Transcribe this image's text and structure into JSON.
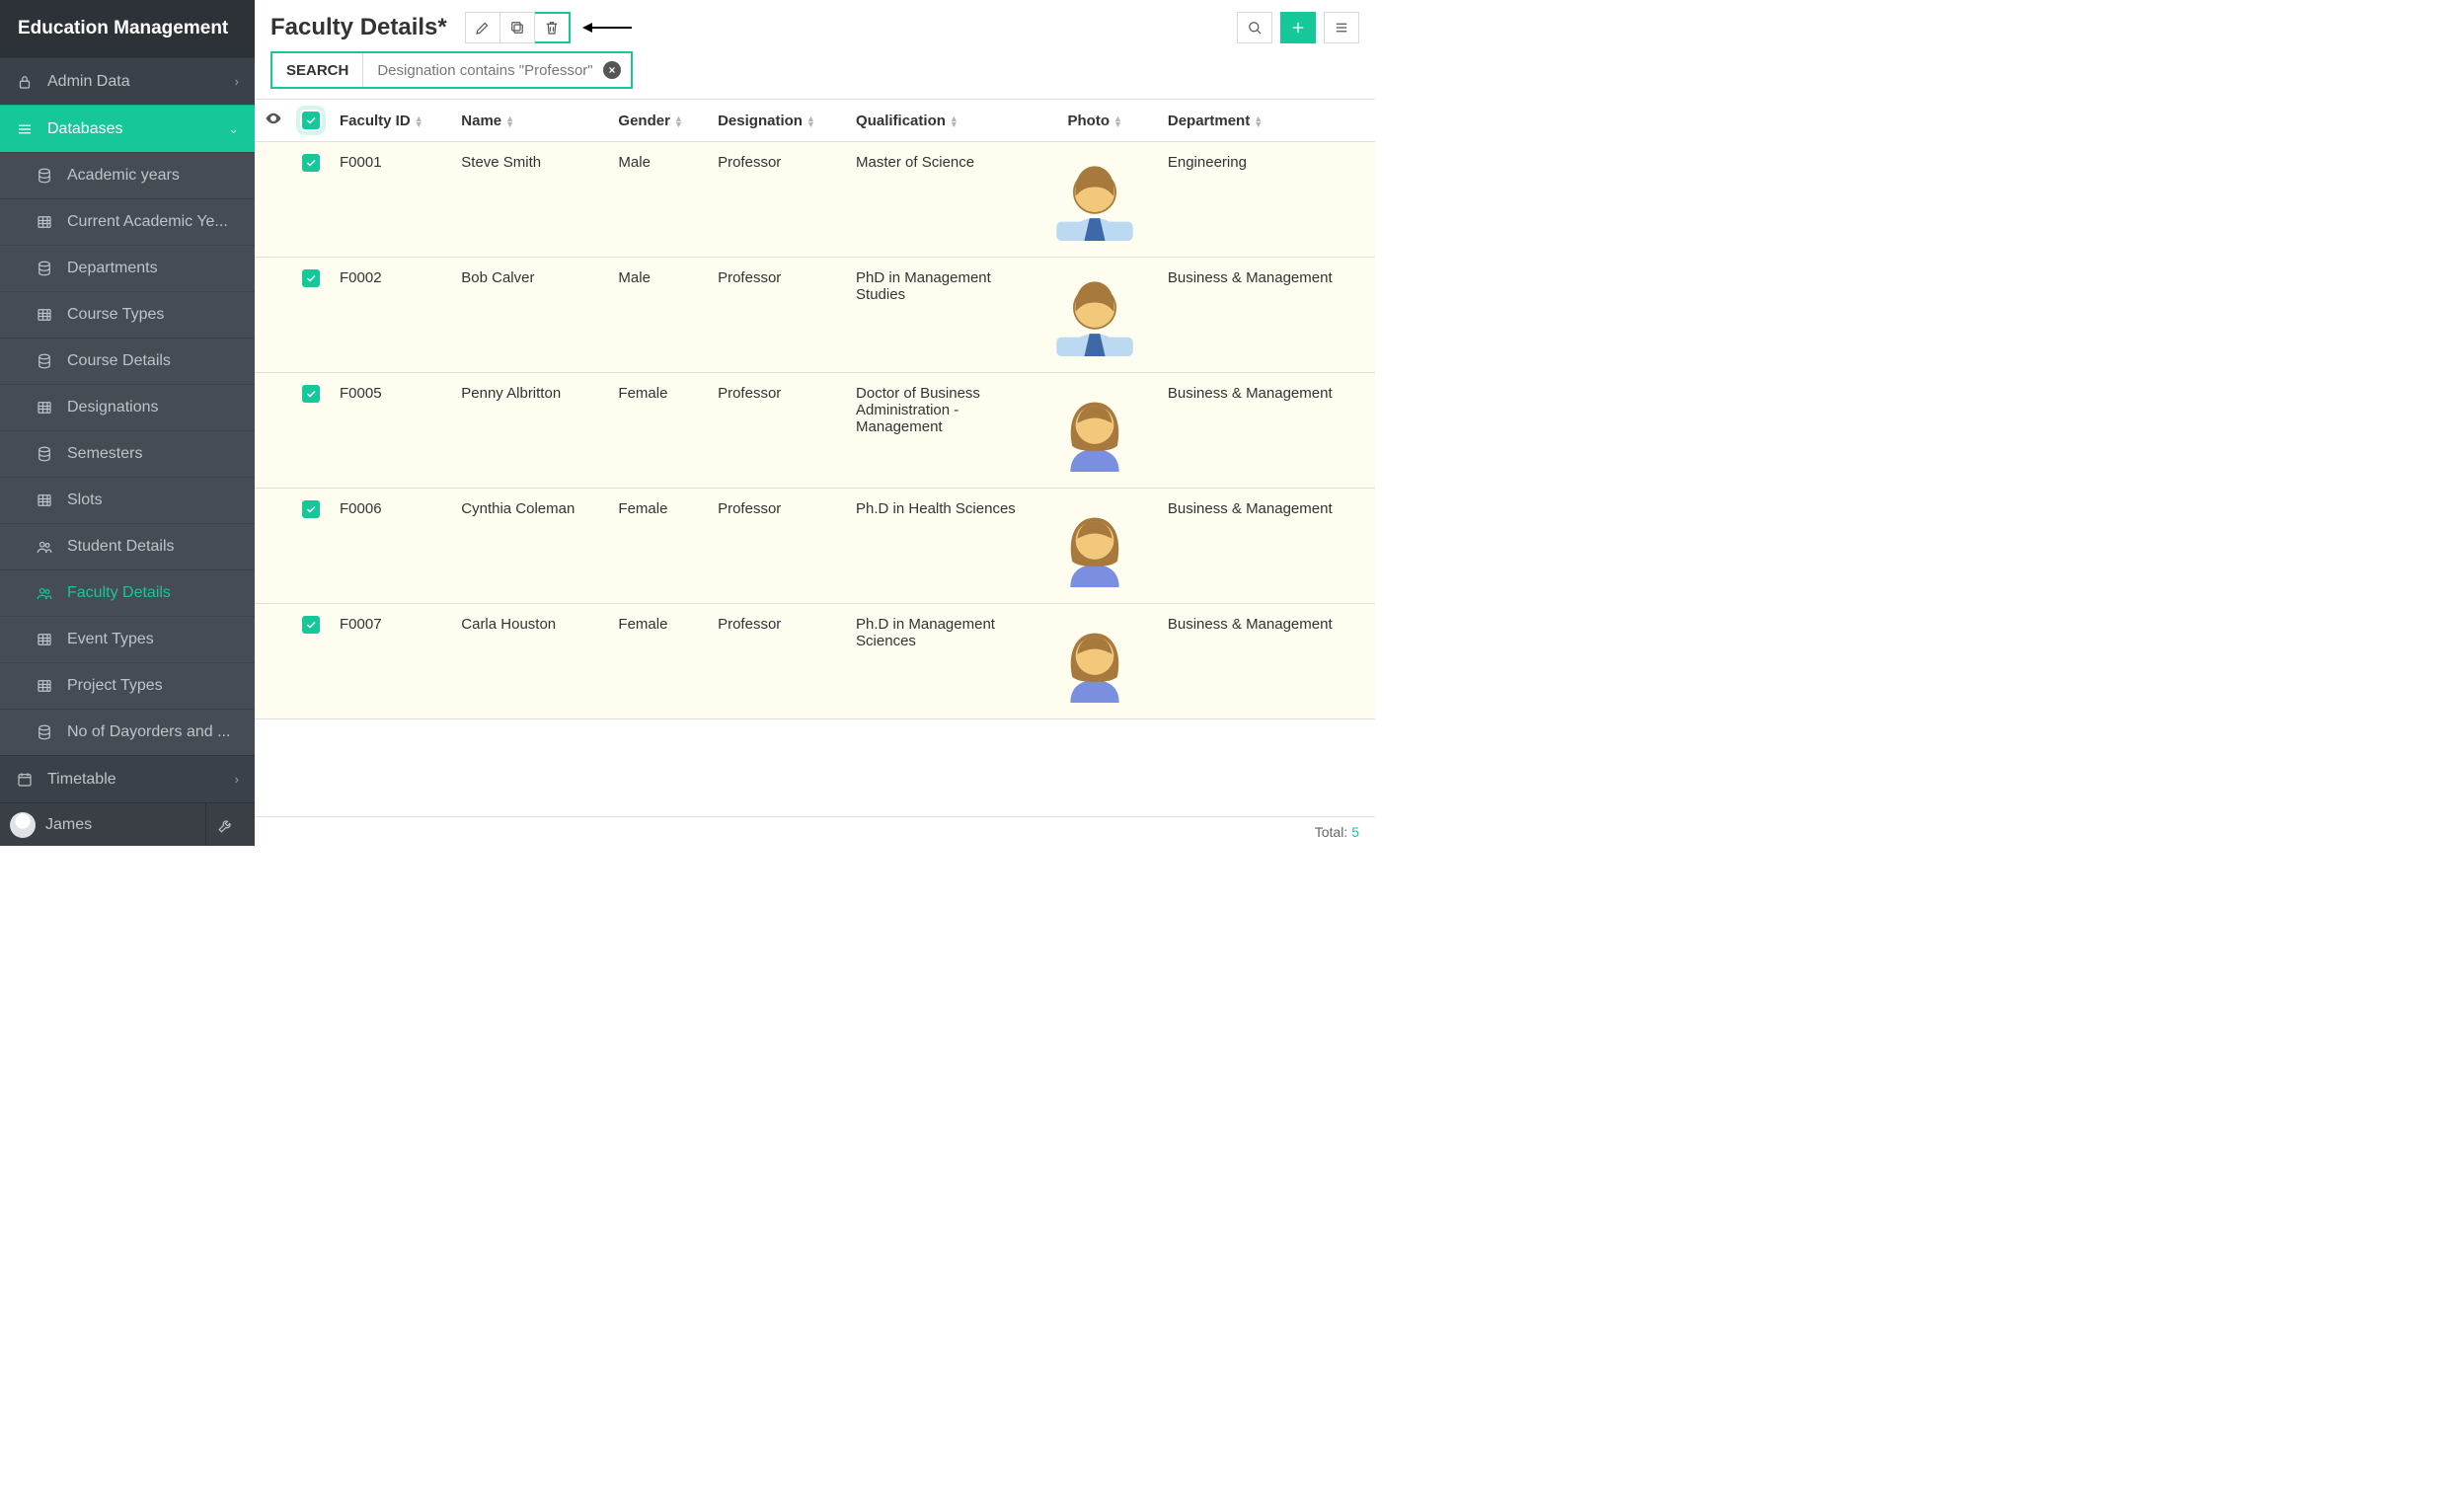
{
  "app_title": "Education Management",
  "sidebar": {
    "sections": [
      {
        "id": "admin",
        "label": "Admin Data",
        "icon": "lock",
        "expanded": false
      },
      {
        "id": "databases",
        "label": "Databases",
        "icon": "menu",
        "expanded": true,
        "active": true
      },
      {
        "id": "timetable",
        "label": "Timetable",
        "icon": "calendar",
        "expanded": false
      }
    ],
    "databases_items": [
      {
        "label": "Academic years",
        "icon": "db"
      },
      {
        "label": "Current Academic Ye...",
        "icon": "table"
      },
      {
        "label": "Departments",
        "icon": "db"
      },
      {
        "label": "Course Types",
        "icon": "table"
      },
      {
        "label": "Course Details",
        "icon": "db"
      },
      {
        "label": "Designations",
        "icon": "table"
      },
      {
        "label": "Semesters",
        "icon": "db"
      },
      {
        "label": "Slots",
        "icon": "table"
      },
      {
        "label": "Student Details",
        "icon": "users"
      },
      {
        "label": "Faculty Details",
        "icon": "users",
        "active": true
      },
      {
        "label": "Event Types",
        "icon": "table"
      },
      {
        "label": "Project Types",
        "icon": "table"
      },
      {
        "label": "No of Dayorders and ...",
        "icon": "db"
      }
    ]
  },
  "user": {
    "name": "James"
  },
  "page": {
    "title": "Faculty Details*"
  },
  "search": {
    "label": "SEARCH",
    "query_display": "Designation contains \"Professor\""
  },
  "columns": [
    "Faculty ID",
    "Name",
    "Gender",
    "Designation",
    "Qualification",
    "Photo",
    "Department"
  ],
  "rows": [
    {
      "checked": true,
      "faculty_id": "F0001",
      "name": "Steve Smith",
      "gender": "Male",
      "designation": "Professor",
      "qualification": "Master of Science",
      "avatar": "male",
      "department": "Engineering"
    },
    {
      "checked": true,
      "faculty_id": "F0002",
      "name": "Bob Calver",
      "gender": "Male",
      "designation": "Professor",
      "qualification": "PhD in Management Studies",
      "avatar": "male",
      "department": "Business & Management"
    },
    {
      "checked": true,
      "faculty_id": "F0005",
      "name": "Penny Albritton",
      "gender": "Female",
      "designation": "Professor",
      "qualification": "Doctor of Business Administration - Management",
      "avatar": "female",
      "department": "Business & Management"
    },
    {
      "checked": true,
      "faculty_id": "F0006",
      "name": "Cynthia Coleman",
      "gender": "Female",
      "designation": "Professor",
      "qualification": "Ph.D in Health Sciences",
      "avatar": "female",
      "department": "Business & Management"
    },
    {
      "checked": true,
      "faculty_id": "F0007",
      "name": "Carla Houston",
      "gender": "Female",
      "designation": "Professor",
      "qualification": "Ph.D in Management Sciences",
      "avatar": "female",
      "department": "Business & Management"
    }
  ],
  "footer": {
    "total_label": "Total:",
    "total_count": "5"
  }
}
